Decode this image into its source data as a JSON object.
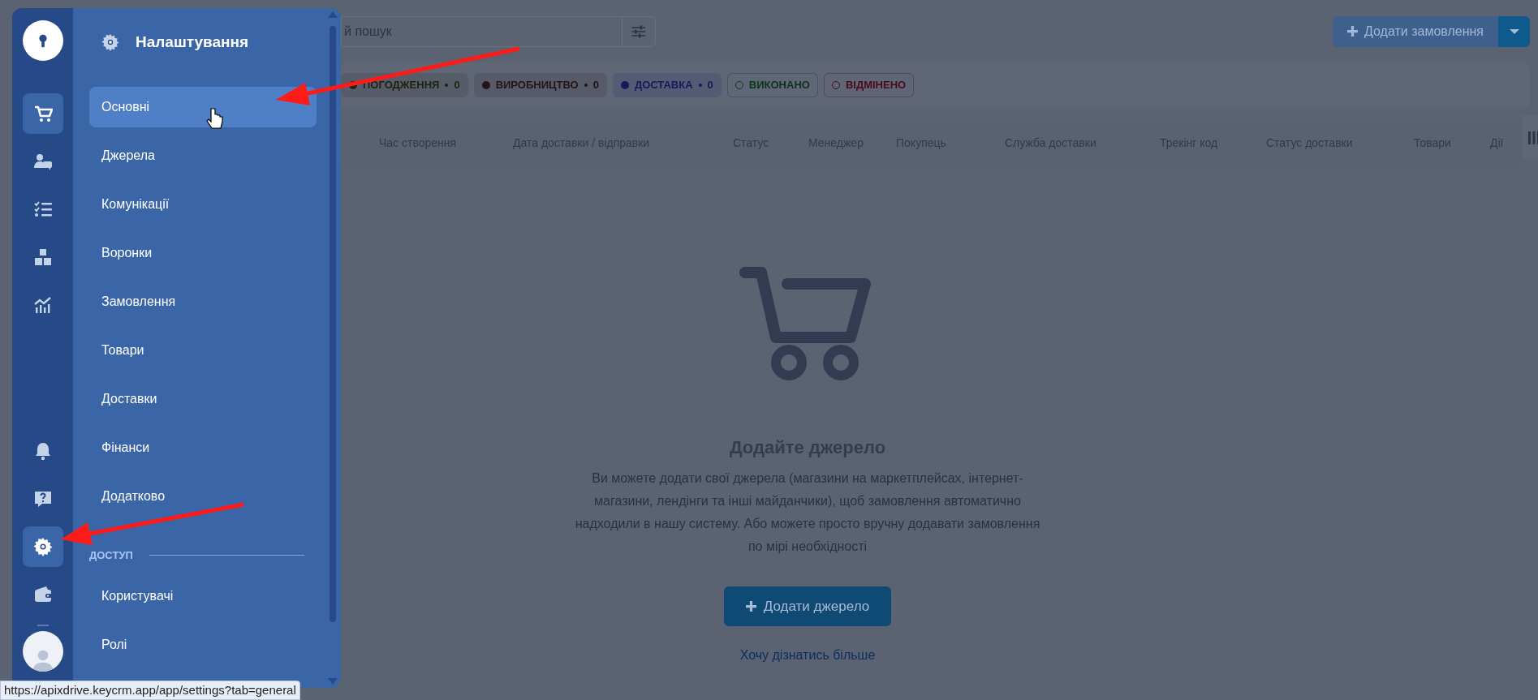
{
  "rail": {
    "top_items": [
      {
        "kind": "cart",
        "selected": true
      },
      {
        "kind": "users",
        "selected": false
      },
      {
        "kind": "tasks",
        "selected": false
      },
      {
        "kind": "boxes",
        "selected": false
      },
      {
        "kind": "chart",
        "selected": false
      }
    ],
    "bottom_items": [
      {
        "kind": "bell",
        "selected": false
      },
      {
        "kind": "help",
        "selected": false
      },
      {
        "kind": "gear",
        "selected": true
      },
      {
        "kind": "wallet",
        "selected": false
      }
    ]
  },
  "settings_panel": {
    "title": "Налаштування",
    "items": [
      {
        "label": "Основні",
        "selected": true
      },
      {
        "label": "Джерела",
        "selected": false
      },
      {
        "label": "Комунікації",
        "selected": false
      },
      {
        "label": "Воронки",
        "selected": false
      },
      {
        "label": "Замовлення",
        "selected": false
      },
      {
        "label": "Товари",
        "selected": false
      },
      {
        "label": "Доставки",
        "selected": false
      },
      {
        "label": "Фінанси",
        "selected": false
      },
      {
        "label": "Додатково",
        "selected": false
      }
    ],
    "sections": [
      {
        "heading": "ДОСТУП",
        "items": [
          {
            "label": "Користувачі",
            "selected": false
          },
          {
            "label": "Ролі",
            "selected": false
          }
        ]
      }
    ]
  },
  "search": {
    "value": "й пошук"
  },
  "add_order_button": {
    "label": "Додати замовлення"
  },
  "status_tabs": [
    {
      "label": "ПОГОДЖЕННЯ",
      "count": "0",
      "kind": "filled",
      "color": "#20220f"
    },
    {
      "label": "ВИРОБНИЦТВО",
      "count": "0",
      "kind": "filled",
      "color": "#241515"
    },
    {
      "label": "ДОСТАВКА",
      "count": "0",
      "kind": "filled",
      "color": "#141a5a"
    },
    {
      "label": "ВИКОНАНО",
      "kind": "outline",
      "color": "#0c3418"
    },
    {
      "label": "ВІДМІНЕНО",
      "kind": "outline",
      "color": "#4a0a1c"
    }
  ],
  "table": {
    "columns": [
      "Час створення",
      "Дата доставки / відправки",
      "Статус",
      "Менеджер",
      "Покупець",
      "Служба доставки",
      "Трекінг код",
      "Статус доставки",
      "Товари",
      "Дії"
    ]
  },
  "empty_state": {
    "title": "Додайте джерело",
    "text": "Ви можете додати свої джерела (магазини на маркетплейсах, інтернет-магазини, лендінги та інші майданчики), щоб замовлення автоматично надходили в нашу систему. Або можете просто вручну додавати замовлення по мірі необхідності",
    "button": "Додати джерело",
    "link": "Хочу дізнатись більше"
  },
  "status_bar": {
    "url": "https://apixdrive.keycrm.app/app/settings?tab=general"
  }
}
